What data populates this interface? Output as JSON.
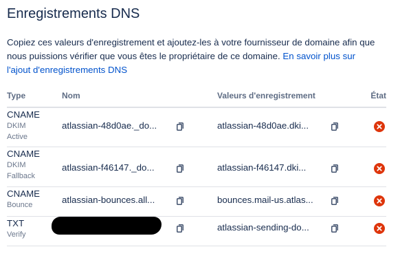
{
  "section": {
    "title": "Enregistrements DNS",
    "description_text": "Copiez ces valeurs d'enregistrement et ajoutez-les à votre fournisseur de domaine afin que nous puissions vérifier que vous êtes le propriétaire de ce domaine. ",
    "learn_more_link": "En savoir plus sur l'ajout d'enregistrements DNS"
  },
  "table": {
    "headers": {
      "type": "Type",
      "name": "Nom",
      "value": "Valeurs d'enregistrement",
      "state": "État"
    },
    "rows": [
      {
        "type": "CNAME",
        "purpose": "DKIM",
        "sub": "Active",
        "name": "atlassian-48d0ae._do...",
        "value": "atlassian-48d0ae.dki...",
        "status_icon": "error-icon"
      },
      {
        "type": "CNAME",
        "purpose": "DKIM",
        "sub": "Fallback",
        "name": "atlassian-f46147._do...",
        "value": "atlassian-f46147.dki...",
        "status_icon": "error-icon"
      },
      {
        "type": "CNAME",
        "purpose": "",
        "sub": "Bounce",
        "name": "atlassian-bounces.all...",
        "value": "bounces.mail-us.atlas...",
        "status_icon": "error-icon"
      },
      {
        "type": "TXT",
        "purpose": "",
        "sub": "Verify",
        "name": "",
        "value": "atlassian-sending-do...",
        "status_icon": "error-icon"
      }
    ]
  },
  "colors": {
    "text": "#172B4D",
    "subtle": "#6B778C",
    "link": "#0052CC",
    "error": "#DE350B",
    "border": "#DFE1E6"
  },
  "icons": {
    "copy": "copy-icon",
    "status": "error-icon"
  }
}
